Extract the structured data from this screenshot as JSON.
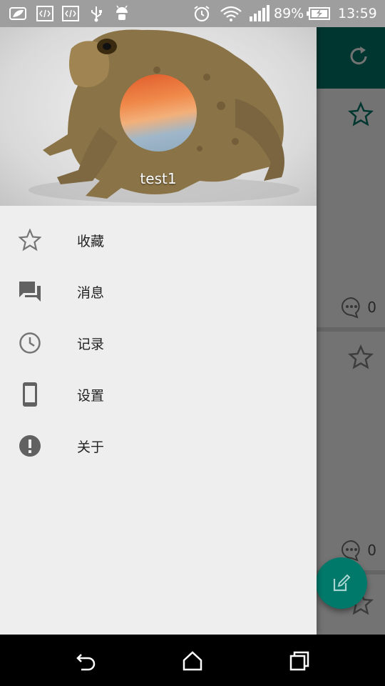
{
  "status_bar": {
    "battery": "89%",
    "time": "13:59",
    "icons": [
      "leaf-icon",
      "code-icon",
      "code-icon",
      "usb-icon",
      "android-icon",
      "alarm-icon",
      "wifi-icon",
      "signal-icon",
      "battery-charging-icon"
    ]
  },
  "drawer": {
    "username": "test1",
    "header_image": "toad-photo",
    "menu": [
      {
        "label": "收藏",
        "icon": "star-outline-icon"
      },
      {
        "label": "消息",
        "icon": "forum-icon"
      },
      {
        "label": "记录",
        "icon": "clock-icon"
      },
      {
        "label": "设置",
        "icon": "phone-icon"
      },
      {
        "label": "关于",
        "icon": "info-circle-icon"
      }
    ]
  },
  "background": {
    "toolbar_color": "#00796b",
    "cards": [
      {
        "comments": "0"
      },
      {
        "comments": "0"
      }
    ]
  },
  "colors": {
    "accent": "#00796b",
    "drawer_bg": "#eeeeee",
    "icon_gray": "#757575"
  }
}
